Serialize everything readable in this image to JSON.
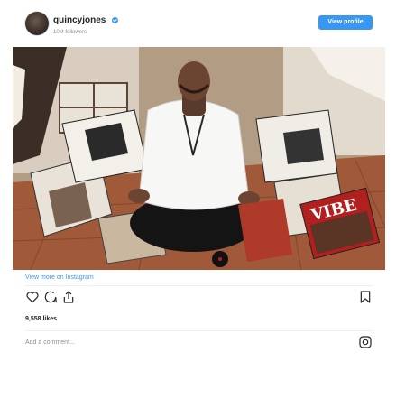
{
  "header": {
    "username": "quincyjones",
    "followers": "10M followers",
    "view_profile_label": "View profile"
  },
  "photo": {
    "magazine_title": "VIBE"
  },
  "footer": {
    "view_more_label": "View more on Instagram",
    "likes": "9,558 likes",
    "comment_placeholder": "Add a comment..."
  },
  "colors": {
    "accent": "#3897f0",
    "text": "#262626",
    "muted": "#8e8e8e"
  },
  "icons": [
    "heart-icon",
    "comment-icon",
    "share-icon",
    "bookmark-icon",
    "instagram-logo-icon"
  ]
}
